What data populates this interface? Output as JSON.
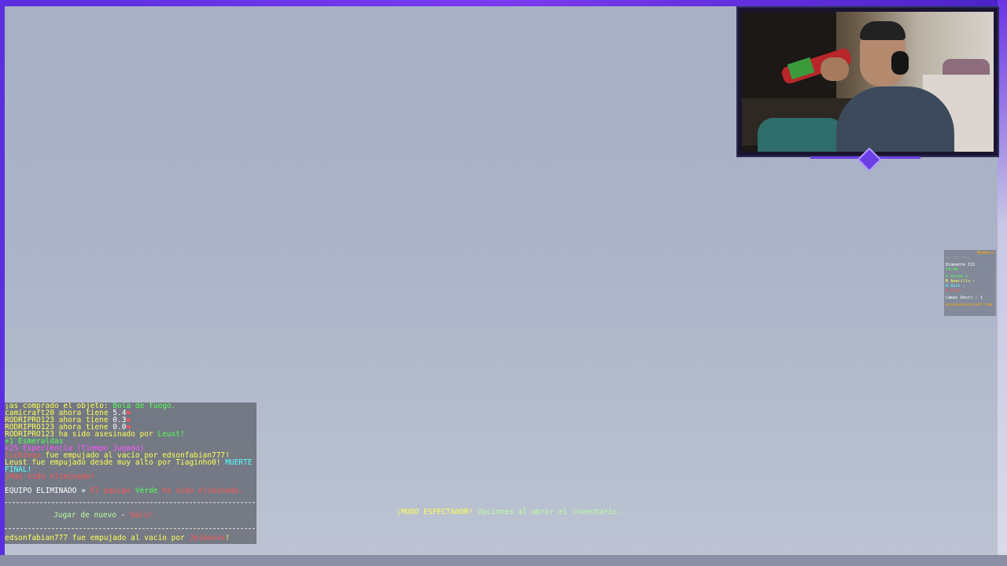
{
  "chat": {
    "lines": [
      {
        "a": "¡as comprado el objeto: ",
        "b": "Bola de fuego."
      },
      {
        "a": "camicraft20 ahora tiene ",
        "b": "5.4",
        "c": "❤"
      },
      {
        "a": "RODRIPRO123 ahora tiene ",
        "b": "0.3",
        "c": "❤"
      },
      {
        "a": "RODRIPRO123 ahora tiene ",
        "b": "0.0",
        "c": "❤"
      },
      {
        "a": "RODRIPRO123 ha sido asesinado por ",
        "b": "Leust!"
      },
      {
        "a": "+1 Esmeraldas"
      },
      {
        "a": "+25 Experiencia (Tiempo Jugado)"
      },
      {
        "a": "lichinxx",
        "b": " fue empujado al vacío por edsonfabian777!"
      },
      {
        "a": "Leust fue empujado desde muy alto por Tiaginho0! ",
        "b": "MUERTE"
      },
      {
        "a": "FINAL!"
      },
      {
        "a": "¡Has sido eliminado!"
      }
    ],
    "eliminated": {
      "label": "EQUIPO ELIMINADO »",
      "p1": " El equipo ",
      "team": "Verde",
      "p2": " ha sido eliminado."
    },
    "menu": {
      "play_again": "Jugar de nuevo",
      "sep": " - ",
      "exit": "Salir"
    },
    "last": {
      "a": "edsonfabian777 fue empujado al vacío por ",
      "b": "Jeibovvs",
      "c": "!"
    }
  },
  "spectator": {
    "label": "¡MODO ESPECTADOR!",
    "hint": " Opciones al abrir el inventario."
  },
  "scoreboard": {
    "title": "BedWars",
    "date": "01/06/2021",
    "lines": [
      "Diamante III",
      "14:40",
      "V Verde ✗",
      "M Amarillo ✓",
      "A Azul ✓",
      "R Rojo ✓",
      "Camas Destr.: 1",
      "mcuniversocraft.com"
    ]
  },
  "colors": {
    "frame": "#5b2fe0",
    "accent_diamond": "#6a3fe6"
  }
}
